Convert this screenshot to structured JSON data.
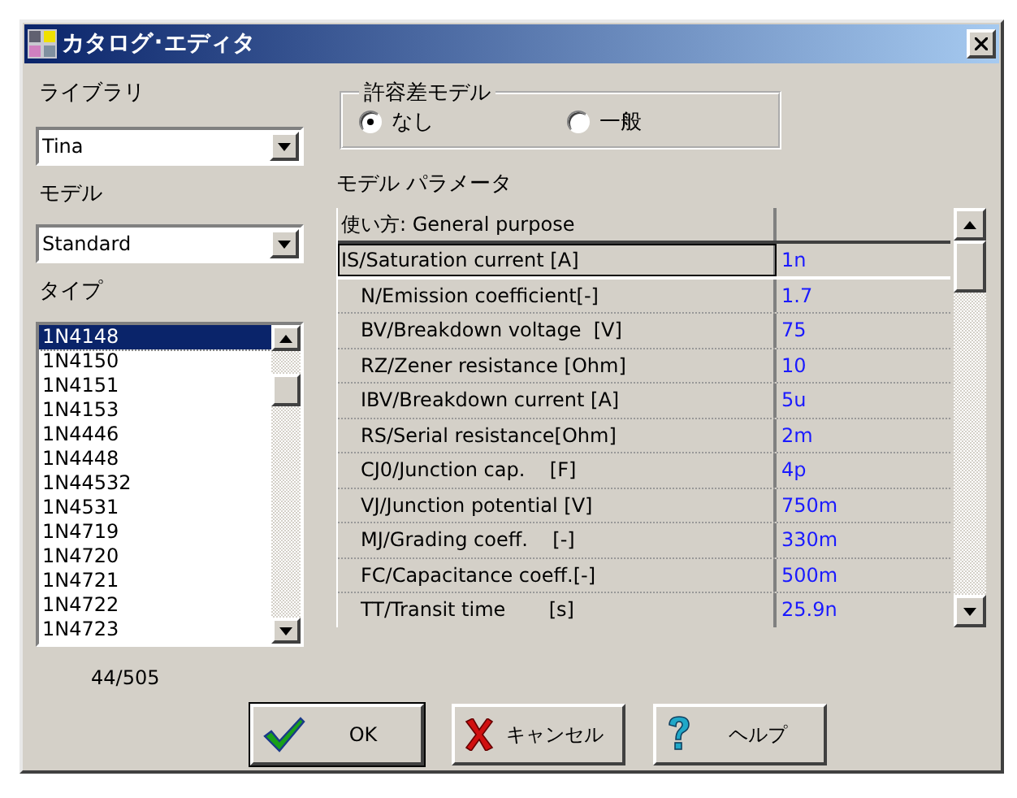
{
  "window": {
    "title": "カタログ･エディタ"
  },
  "library": {
    "label": "ライブラリ",
    "value": "Tina"
  },
  "model": {
    "label": "モデル",
    "value": "Standard"
  },
  "type": {
    "label": "タイプ",
    "items": [
      {
        "text": "1N4148",
        "selected": true
      },
      {
        "text": "1N4150",
        "selected": false
      },
      {
        "text": "1N4151",
        "selected": false
      },
      {
        "text": "1N4153",
        "selected": false
      },
      {
        "text": "1N4446",
        "selected": false
      },
      {
        "text": "1N4448",
        "selected": false
      },
      {
        "text": "1N44532",
        "selected": false
      },
      {
        "text": "1N4531",
        "selected": false
      },
      {
        "text": "1N4719",
        "selected": false
      },
      {
        "text": "1N4720",
        "selected": false
      },
      {
        "text": "1N4721",
        "selected": false
      },
      {
        "text": "1N4722",
        "selected": false
      },
      {
        "text": "1N4723",
        "selected": false
      }
    ],
    "count": "44/505"
  },
  "tolerance": {
    "title": "許容差モデル",
    "options": [
      {
        "label": "なし",
        "selected": true
      },
      {
        "label": "一般",
        "selected": false
      }
    ]
  },
  "parameters": {
    "title": "モデル パラメータ",
    "usage": "使い方: General purpose",
    "rows": [
      {
        "name": "IS/Saturation current [A]",
        "value": "1n",
        "selected": true
      },
      {
        "name": "N/Emission coefficient[-]",
        "value": "1.7",
        "selected": false
      },
      {
        "name": "BV/Breakdown voltage  [V]",
        "value": "75",
        "selected": false
      },
      {
        "name": "RZ/Zener resistance [Ohm]",
        "value": "10",
        "selected": false
      },
      {
        "name": "IBV/Breakdown current [A]",
        "value": "5u",
        "selected": false
      },
      {
        "name": "RS/Serial resistance[Ohm]",
        "value": "2m",
        "selected": false
      },
      {
        "name": "CJ0/Junction cap.    [F]",
        "value": "4p",
        "selected": false
      },
      {
        "name": "VJ/Junction potential [V]",
        "value": "750m",
        "selected": false
      },
      {
        "name": "MJ/Grading coeff.    [-]",
        "value": "330m",
        "selected": false
      },
      {
        "name": "FC/Capacitance coeff.[-]",
        "value": "500m",
        "selected": false
      },
      {
        "name": "TT/Transit time       [s]",
        "value": "25.9n",
        "selected": false
      }
    ]
  },
  "buttons": [
    {
      "label": "OK",
      "kind": "ok",
      "default": true
    },
    {
      "label": "キャンセル",
      "kind": "cancel",
      "default": false
    },
    {
      "label": "ヘルプ",
      "kind": "help",
      "default": false
    }
  ]
}
